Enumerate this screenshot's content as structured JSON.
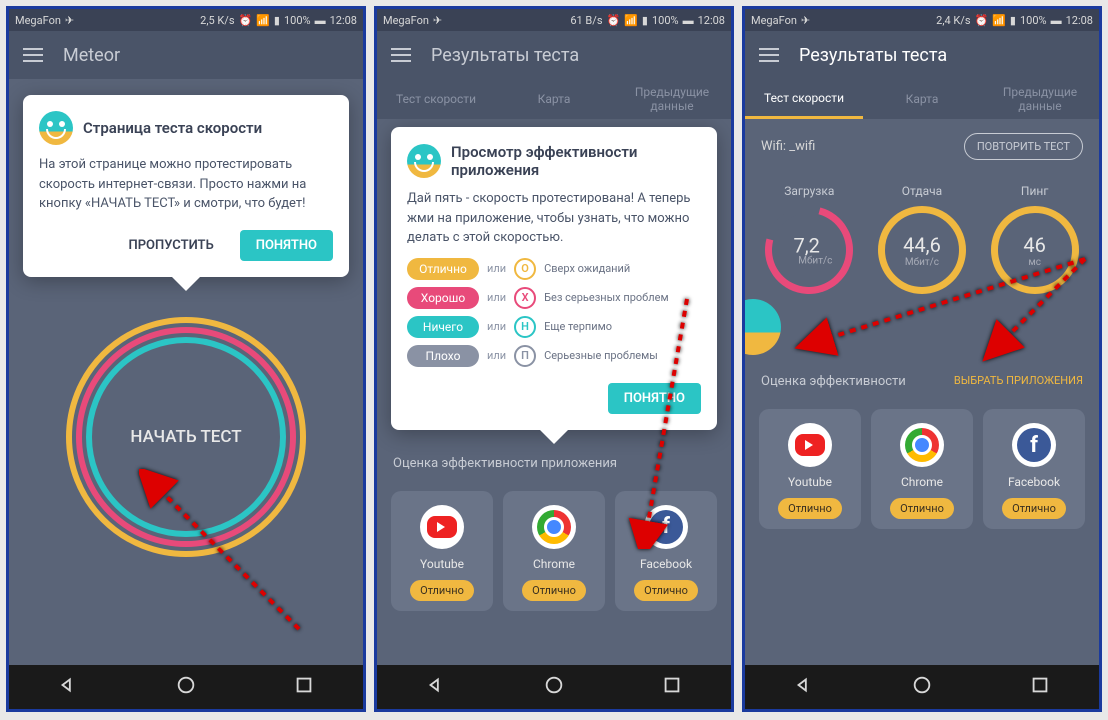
{
  "status": {
    "carrier": "MegaFon",
    "speed1": "2,5 K/s",
    "speed2": "61 B/s",
    "speed3": "2,4 K/s",
    "battery": "100%",
    "time": "12:08"
  },
  "screen1": {
    "title": "Meteor",
    "tooltip_title": "Страница теста скорости",
    "tooltip_text": "На этой странице можно протестировать скорость интернет-связи. Просто нажми на кнопку «НАЧАТЬ ТЕСТ» и смотри, что будет!",
    "skip": "ПРОПУСТИТЬ",
    "ok": "ПОНЯТНО",
    "start": "НАЧАТЬ ТЕСТ"
  },
  "screen2": {
    "title": "Результаты теста",
    "tabs": [
      "Тест скорости",
      "Карта",
      "Предыдущие данные"
    ],
    "tooltip_title": "Просмотр эффективности приложения",
    "tooltip_text": "Дай пять - скорость протестирована! А теперь жми на приложение, чтобы узнать, что можно делать с этой скоростью.",
    "legend": {
      "excellent": "Отлично",
      "excellent_desc": "Сверх ожиданий",
      "good": "Хорошо",
      "good_desc": "Без серьезных проблем",
      "nothing": "Ничего",
      "nothing_desc": "Еще терпимо",
      "bad": "Плохо",
      "bad_desc": "Серьезные проблемы",
      "or": "или"
    },
    "ok": "ПОНЯТНО",
    "efficiency": "Оценка эффективности приложения"
  },
  "screen3": {
    "title": "Результаты теста",
    "tabs": [
      "Тест скорости",
      "Карта",
      "Предыдущие данные"
    ],
    "wifi_label": "Wifi:",
    "wifi_name": "_wifi",
    "retry": "ПОВТОРИТЬ ТЕСТ",
    "metrics": {
      "download": {
        "label": "Загрузка",
        "value": "7,2",
        "unit": "Мбит/с"
      },
      "upload": {
        "label": "Отдача",
        "value": "44,6",
        "unit": "Мбит/с"
      },
      "ping": {
        "label": "Пинг",
        "value": "46",
        "unit": "мс"
      }
    },
    "efficiency": "Оценка эффективности",
    "select_apps": "ВЫБРАТЬ ПРИЛОЖЕНИЯ"
  },
  "apps": [
    {
      "name": "Youtube",
      "rating": "Отлично"
    },
    {
      "name": "Chrome",
      "rating": "Отлично"
    },
    {
      "name": "Facebook",
      "rating": "Отлично"
    }
  ]
}
